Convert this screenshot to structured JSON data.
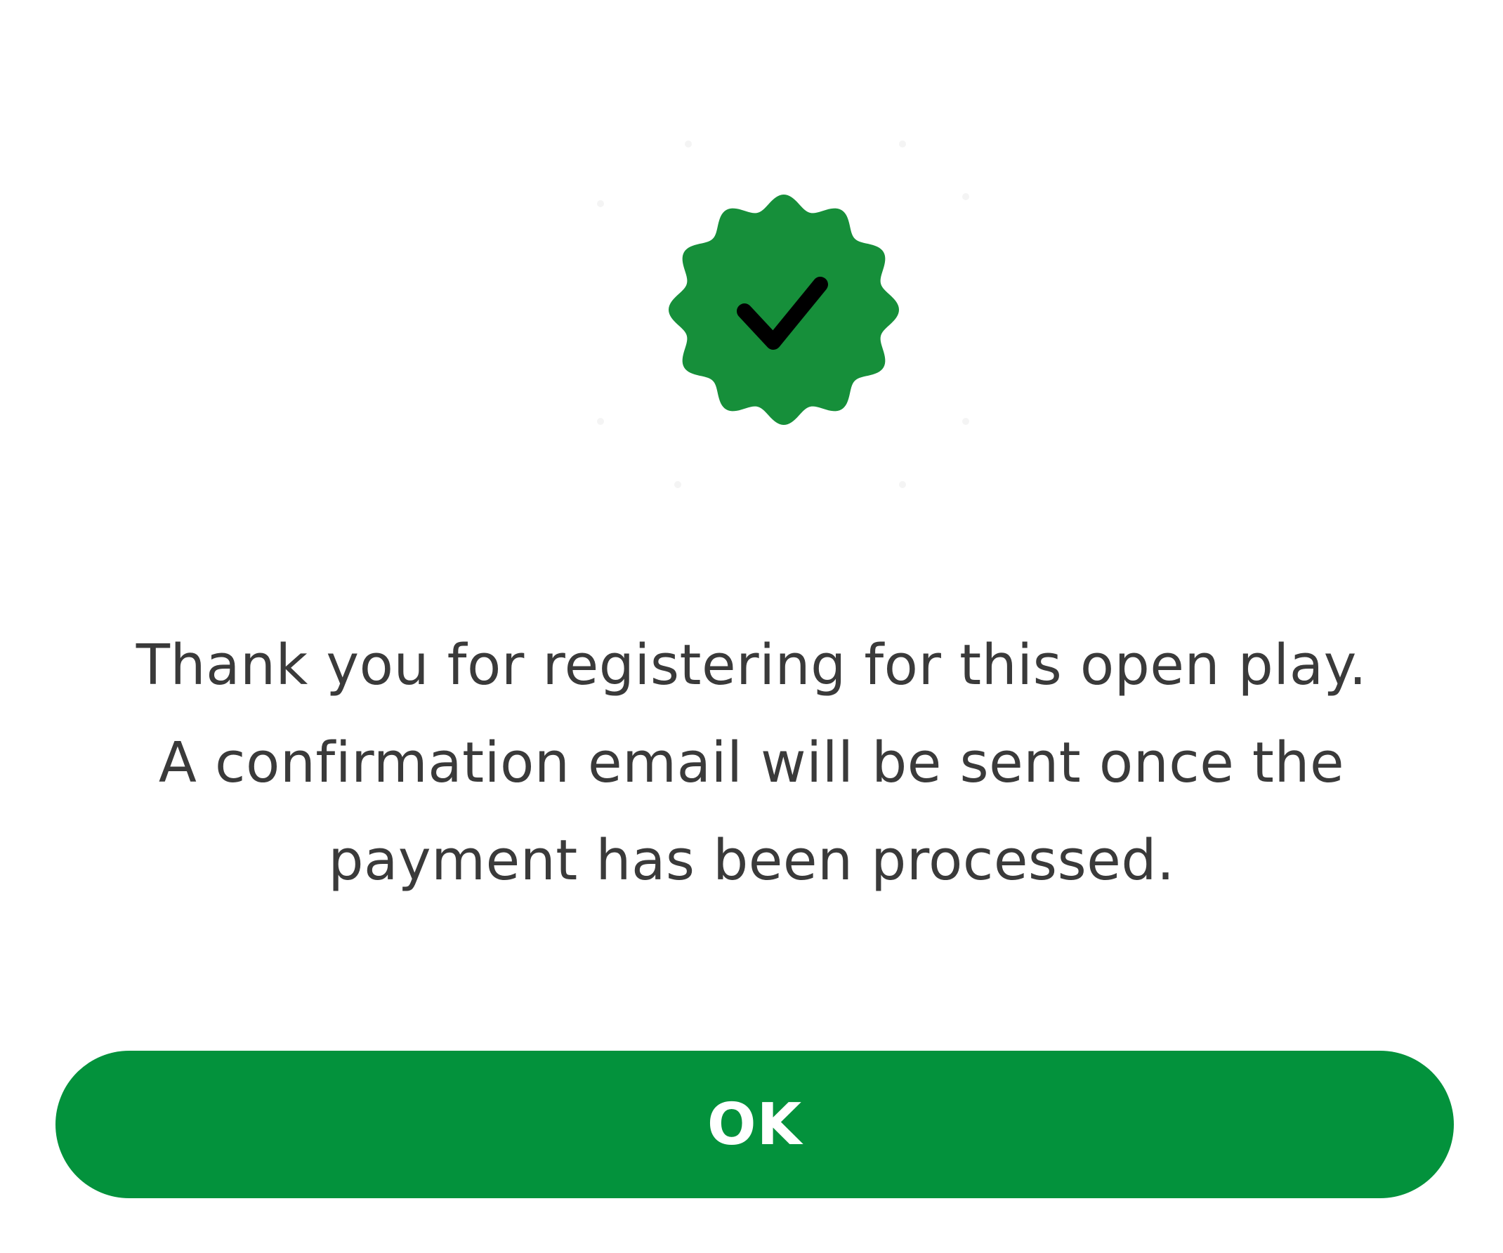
{
  "dialog": {
    "icon": "verified-check-badge-icon",
    "message_lines": [
      "Thank you for registering for this open play.",
      "A confirmation email will be sent once the",
      "payment has been processed."
    ],
    "ok_label": "OK"
  },
  "colors": {
    "badge": "#168f3a",
    "check": "#000000",
    "button": "#03923c",
    "button_text": "#ffffff",
    "text": "#3a3a3a",
    "background": "#ffffff"
  }
}
